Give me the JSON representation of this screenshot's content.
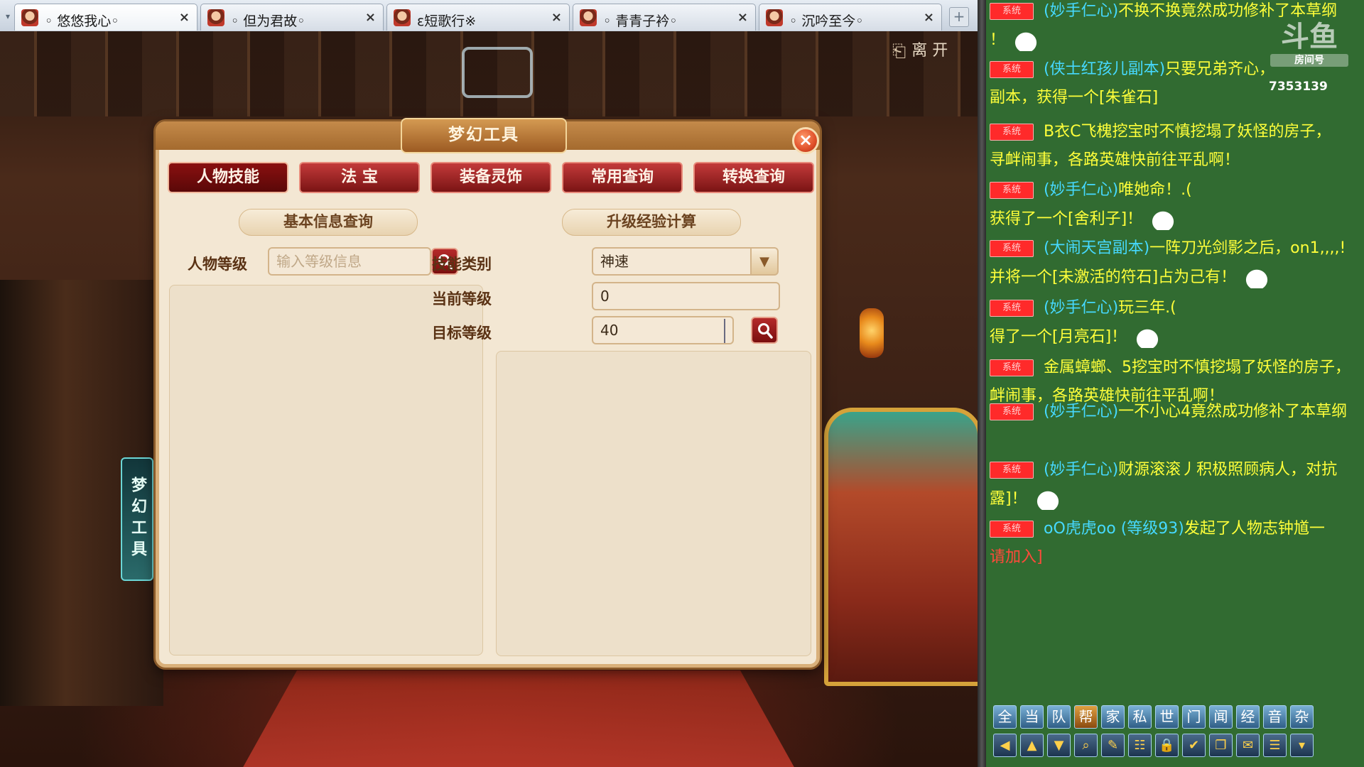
{
  "tabs": [
    {
      "label": "◦ 悠悠我心◦",
      "close": "×",
      "active": true
    },
    {
      "label": "◦ 但为君故◦",
      "close": "×",
      "active": false
    },
    {
      "label": "ε短歌行※",
      "close": "×",
      "active": false
    },
    {
      "label": "◦ 青青子衿◦",
      "close": "×",
      "active": false
    },
    {
      "label": "◦ 沉吟至今◦",
      "close": "×",
      "active": false
    }
  ],
  "tab_add": "+",
  "scene": {
    "leave_label": "离 开",
    "side_label": "梦幻工具"
  },
  "dialog": {
    "title": "梦幻工具",
    "close": "×",
    "tabs": [
      "人物技能",
      "法 宝",
      "装备灵饰",
      "常用查询",
      "转换查询"
    ],
    "left_section": {
      "title": "基本信息查询",
      "level_label": "人物等级",
      "level_placeholder": "输入等级信息"
    },
    "right_section": {
      "title": "升级经验计算",
      "skill_label": "技能类别",
      "skill_value": "神速",
      "current_label": "当前等级",
      "current_value": "0",
      "target_label": "目标等级",
      "target_value": "40"
    }
  },
  "chat": {
    "logo_text": "斗鱼",
    "room_label": "房间号",
    "room_number": "7353139",
    "sys_tag": "系统",
    "messages": [
      {
        "lines": [
          {
            "text": "(妙手仁心)",
            "color": "cyan"
          },
          {
            "text": "不换不换竟然成功修补了本草纲",
            "color": "yellow"
          }
        ],
        "line2": "！",
        "tag": true
      },
      {
        "lines": [
          {
            "text": "(侠士红孩儿副本)",
            "color": "cyan"
          },
          {
            "text": "只要兄弟齐心，",
            "color": "yellow"
          }
        ],
        "line2": "副本，获得一个[朱雀石]",
        "tag": true
      },
      {
        "lines": [
          {
            "text": "B衣C飞槐挖宝时不慎挖塌了妖怪的房子，",
            "color": "yellow"
          }
        ],
        "line2": "寻衅闹事，各路英雄快前往平乱啊！",
        "tag": true
      },
      {
        "lines": [
          {
            "text": "(妙手仁心)",
            "color": "cyan"
          },
          {
            "text": "唯她命！.(",
            "color": "yellow"
          }
        ],
        "line2": "获得了一个[舍利子]！",
        "tag": true
      },
      {
        "lines": [
          {
            "text": "(大闹天宫副本)",
            "color": "cyan"
          },
          {
            "text": "一阵刀光剑影之后，on1,,,,!",
            "color": "yellow"
          }
        ],
        "line2": "并将一个[未激活的符石]占为己有！",
        "tag": true
      },
      {
        "lines": [
          {
            "text": "(妙手仁心)",
            "color": "cyan"
          },
          {
            "text": "玩三年.(",
            "color": "yellow"
          }
        ],
        "line2": "得了一个[月亮石]！",
        "tag": true
      },
      {
        "lines": [
          {
            "text": "金属蟑螂、5挖宝时不慎挖塌了妖怪的房子，",
            "color": "yellow"
          }
        ],
        "line2": "衅闹事，各路英雄快前往平乱啊！",
        "tag": true
      },
      {
        "lines": [
          {
            "text": "(妙手仁心)",
            "color": "cyan"
          },
          {
            "text": "一不小心4竟然成功修补了本草纲",
            "color": "yellow"
          }
        ],
        "line2": "",
        "tag": true
      },
      {
        "lines": [
          {
            "text": "(妙手仁心)",
            "color": "cyan"
          },
          {
            "text": "财源滚滚丿积极照顾病人，对抗",
            "color": "yellow"
          }
        ],
        "line2": "露]！",
        "tag": true
      },
      {
        "lines": [
          {
            "text": "oO虎虎oo (等级93)",
            "color": "cyan"
          },
          {
            "text": "发起了人物志钟馗一",
            "color": "yellow"
          }
        ],
        "line2": "请加入]",
        "tag": true
      }
    ],
    "channels": [
      "全",
      "当",
      "队",
      "帮",
      "家",
      "私",
      "世",
      "门",
      "闻",
      "经",
      "音",
      "杂"
    ],
    "active_channel": "帮",
    "tools": [
      "back-icon",
      "up-icon",
      "down-icon",
      "search-icon",
      "note-icon",
      "group-icon",
      "lock-icon",
      "check-icon",
      "window-icon",
      "bubble-icon",
      "list-icon",
      "dropdown-icon"
    ]
  },
  "colors": {
    "chat_bg": "#316b31",
    "dialog_bg": "#f3e7d3",
    "tab_red": "#a01818",
    "msg_cyan": "#46d9ff",
    "msg_yellow": "#ffff3a",
    "sys_red": "#ff2a2a"
  }
}
